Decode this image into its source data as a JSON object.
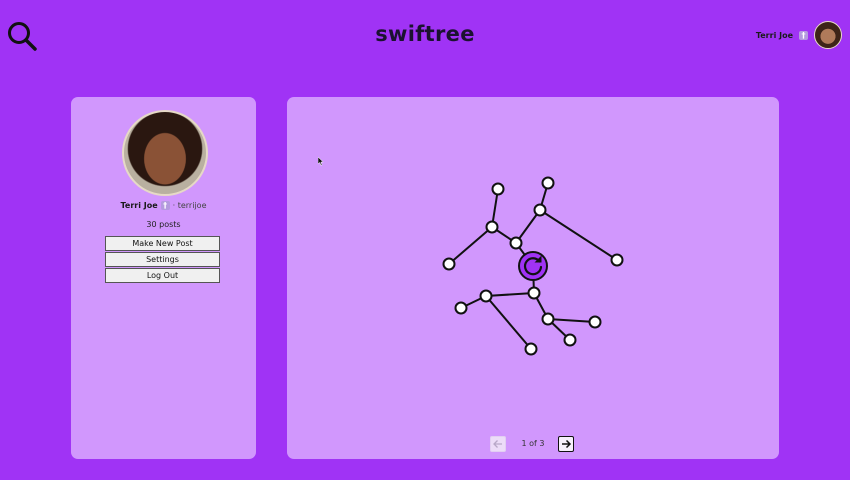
{
  "header": {
    "brand": "swiftree",
    "user_name": "Terri Joe",
    "badge_glyph": "†"
  },
  "profile": {
    "name": "Terri Joe",
    "badge_glyph": "†",
    "handle": "· terrijoe",
    "post_count": "30 posts"
  },
  "menu": {
    "new_post": "Make New Post",
    "settings": "Settings",
    "logout": "Log Out"
  },
  "pager": {
    "text": "1 of 3"
  },
  "colors": {
    "background": "#a033f5",
    "panel": "#d197fd",
    "accent": "#a033f5"
  },
  "icons": [
    "search-icon",
    "refresh-icon",
    "arrow-left-icon",
    "arrow-right-icon"
  ]
}
